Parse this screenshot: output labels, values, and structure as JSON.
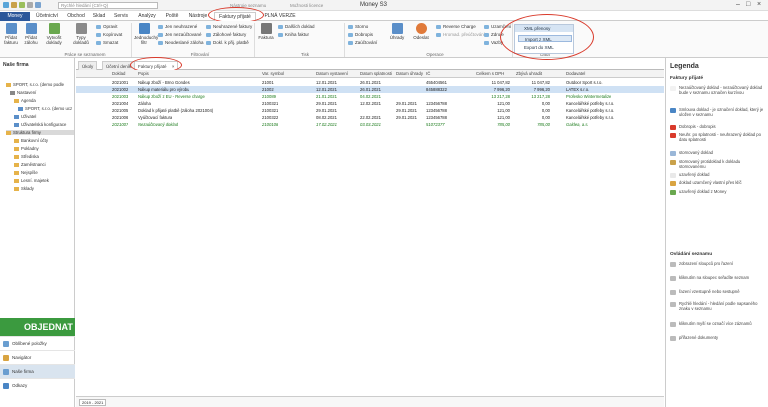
{
  "app": {
    "title": "Money S3",
    "search_placeholder": "Rychlé hledání (Ctrl+Q)"
  },
  "context_header": {
    "primary": "Nástroje seznamu",
    "secondary": "Možnosti licence"
  },
  "tabs": [
    "Money",
    "Účetnictví",
    "Obchod",
    "Sklad",
    "Servis",
    "Analýzy",
    "Poště",
    "Nástroje",
    "Faktury přijaté",
    "PLNÁ VERZE"
  ],
  "ribbon": {
    "big": [
      {
        "label": "Přidat fakturu",
        "icon": "add-invoice-icon"
      },
      {
        "label": "Přidat zálohu",
        "icon": "add-advance-icon"
      },
      {
        "label": "Vytvořit doklady",
        "icon": "create-documents-icon"
      },
      {
        "label": "Typy dokladů",
        "icon": "document-types-icon"
      },
      {
        "label": "Jednoduchý filtr",
        "icon": "filter-icon"
      },
      {
        "label": "Faktura",
        "icon": "invoice-icon"
      },
      {
        "label": "Úhrady",
        "icon": "payments-icon"
      },
      {
        "label": "Odeslat",
        "icon": "send-icon"
      }
    ],
    "small": [
      {
        "label": "Opravit"
      },
      {
        "label": "Kopírovat"
      },
      {
        "label": "Smazat"
      },
      {
        "label": "Jen neuhrazené"
      },
      {
        "label": "Jen nezaúčtované"
      },
      {
        "label": "Neodeslané záloha"
      },
      {
        "label": "Neuhrazené faktury"
      },
      {
        "label": "Zálohové faktury"
      },
      {
        "label": "Dokl. k přij. platbě"
      },
      {
        "label": "Dalších doklad"
      },
      {
        "label": "Kniha faktur"
      },
      {
        "label": "Storno"
      },
      {
        "label": "Dobropis"
      },
      {
        "label": "Zaúčtování"
      },
      {
        "label": "Reverse Charge"
      },
      {
        "label": "Hromad. přeúčtování"
      },
      {
        "label": "Uzamčení"
      },
      {
        "label": "Zdroje"
      },
      {
        "label": "Vazby"
      }
    ],
    "groups": [
      "Práce se seznamem",
      "Filtrování",
      "Tisk",
      "Operace",
      "Data"
    ],
    "xml_menu": {
      "header": "XML přenosy",
      "items": [
        "Import z XML",
        "Export do XML"
      ]
    }
  },
  "nav": {
    "title": "Naše firma",
    "tree": [
      "SPORT, s.r.o. (demo podle",
      "Nastavení",
      "Agenda",
      "SPORT, s.r.o. (demo ucz",
      "Uživatel",
      "Uživatelská konfigurace",
      "Struktura firmy",
      "Bankovní účty",
      "Pokladny",
      "Střediska",
      "Zaměstnanci",
      "Nejspíše",
      "Lesní. majetek",
      "Sklady"
    ],
    "objednat": "OBJEDNAT",
    "bottom": [
      "Oblíbené položky",
      "Navigátor",
      "Naše firma",
      "Odkazy"
    ]
  },
  "doc_tabs": [
    "Úkoly",
    "Účetní deník",
    "Faktury přijaté"
  ],
  "table": {
    "headers": [
      "Doklad",
      "Popis",
      "Var. symbol",
      "Datum vystavení",
      "Datum splatnosti",
      "Datum úhrady",
      "IČ",
      "Celkem s DPH",
      "Zbývá uhradit",
      "Dodavatel"
    ],
    "rows": [
      [
        "2021001",
        "Nákup zboží - Brno Gondes",
        "21001",
        "12.01.2021",
        "26.01.2021",
        "",
        "455404561",
        "11 047,82",
        "11 047,82",
        "Outdoor Sport s.r.o."
      ],
      [
        "2021002",
        "Nákup materiálu pro výrobu",
        "21002",
        "12.01.2021",
        "26.01.2021",
        "",
        "845888322",
        "7 996,20",
        "7 996,20",
        "LATEX s.r.o."
      ],
      [
        "2021003",
        "Nákup zboží z EU - Reverse charge",
        "210089",
        "21.01.2021",
        "04.02.2021",
        "",
        "",
        "13 217,28",
        "13 217,28",
        "Profesko Wintermetalize"
      ],
      [
        "2021004",
        "Záloha",
        "2100321",
        "29.01.2021",
        "12.02.2021",
        "29.01.2021",
        "123456788",
        "121,00",
        "0,00",
        "Kancelářské potřeby s.r.o."
      ],
      [
        "2021005",
        "Doklad k přijaté platbě (záloha 2021004)",
        "2100321",
        "29.01.2021",
        "",
        "29.01.2021",
        "123456788",
        "121,00",
        "0,00",
        "Kancelářské potřeby s.r.o."
      ],
      [
        "2021006",
        "Vyúčtovací faktura",
        "2100322",
        "08.02.2021",
        "22.02.2021",
        "29.01.2021",
        "123456788",
        "121,00",
        "0,00",
        "Kancelářské potřeby s.r.o."
      ],
      [
        "2021007",
        "Nezaúčtovaný doklad",
        "2100108",
        "17.02.2021",
        "03.03.2021",
        "",
        "51072377",
        "785,00",
        "785,00",
        "Galdea, a.s."
      ]
    ]
  },
  "status": {
    "year": "2019 - 2021"
  },
  "legend": {
    "title": "Legenda",
    "section1": "Faktury přijaté",
    "items1": [
      "Nezaúčtovaný doklad - nezaúčtovaný doklad bude v seznamu označen kurzívou",
      "Smlouva doklad - je označení doklad, který je uložen v seznamu",
      "Dobropis - dobropis",
      "Neuhr. po splatnosti - neuhrazený doklad po datu splatnosti",
      "stornovaný doklad",
      "stornovaný protidoklad k dokladu stornovanému",
      "uzavřený doklad",
      "doklad uzamčený vlastní přes klíč",
      "uzavřený doklad z Money"
    ],
    "section2": "Ovládání seznamu",
    "items2": [
      "zobrazení sloupců pro řazení",
      "kliknutím na sloupec seřadíte seznam",
      "řazení vzestupně nebo sestupně",
      "Rychlé hledání - hledání podle napsaného znaku v seznamu",
      "kliknutím myší se označí více záznamů",
      "přiřazené dokumenty"
    ]
  },
  "colors": {
    "accent": "#2b579a",
    "highlight": "#d93a2b",
    "selected_row": "#cfe1f4",
    "green": "#3b9a3f"
  }
}
